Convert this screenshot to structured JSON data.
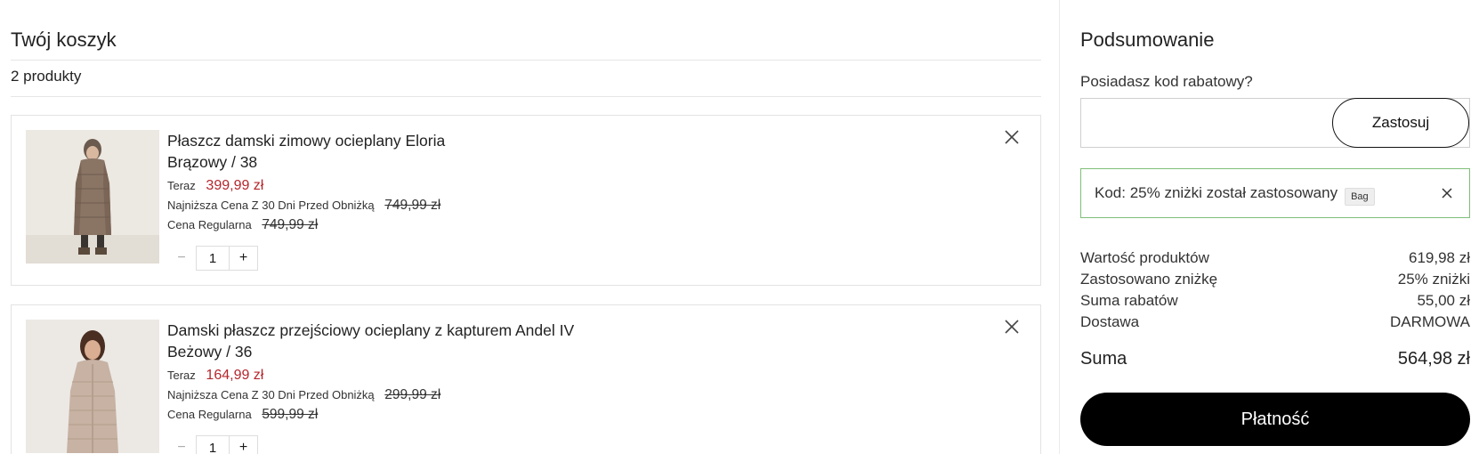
{
  "cart": {
    "title": "Twój koszyk",
    "count_label": "2 produkty",
    "items": [
      {
        "name": "Płaszcz damski zimowy ocieplany Eloria",
        "variant": "Brązowy / 38",
        "now_label": "Teraz",
        "now_price": "399,99 zł",
        "lowest_label": "Najniższa Cena Z 30 Dni Przed Obniżką",
        "lowest_price": "749,99 zł",
        "regular_label": "Cena Regularna",
        "regular_price": "749,99 zł",
        "quantity": "1",
        "minus_symbol": "−",
        "plus_symbol": "+"
      },
      {
        "name": "Damski płaszcz przejściowy ocieplany z kapturem Andel IV",
        "variant": "Beżowy / 36",
        "now_label": "Teraz",
        "now_price": "164,99 zł",
        "lowest_label": "Najniższa Cena Z 30 Dni Przed Obniżką",
        "lowest_price": "299,99 zł",
        "regular_label": "Cena Regularna",
        "regular_price": "599,99 zł",
        "quantity": "1",
        "minus_symbol": "−",
        "plus_symbol": "+"
      }
    ]
  },
  "summary": {
    "title": "Podsumowanie",
    "code_question": "Posiadasz kod rabatowy?",
    "code_placeholder": "",
    "apply_label": "Zastosuj",
    "applied_message": "Kod: 25% zniżki został zastosowany",
    "applied_tag": "Bag",
    "lines": [
      {
        "label": "Wartość produktów",
        "value": "619,98 zł"
      },
      {
        "label": "Zastosowano zniżkę",
        "value": "25% zniżki"
      },
      {
        "label": "Suma rabatów",
        "value": "55,00 zł"
      },
      {
        "label": "Dostawa",
        "value": "DARMOWA"
      }
    ],
    "total_label": "Suma",
    "total_value": "564,98 zł",
    "pay_label": "Płatność"
  },
  "colors": {
    "sale_price": "#b5262c",
    "applied_border": "#7fbf7a",
    "pay_button": "#000000"
  },
  "icons": {
    "remove": "close-icon",
    "applied_close": "close-icon"
  }
}
